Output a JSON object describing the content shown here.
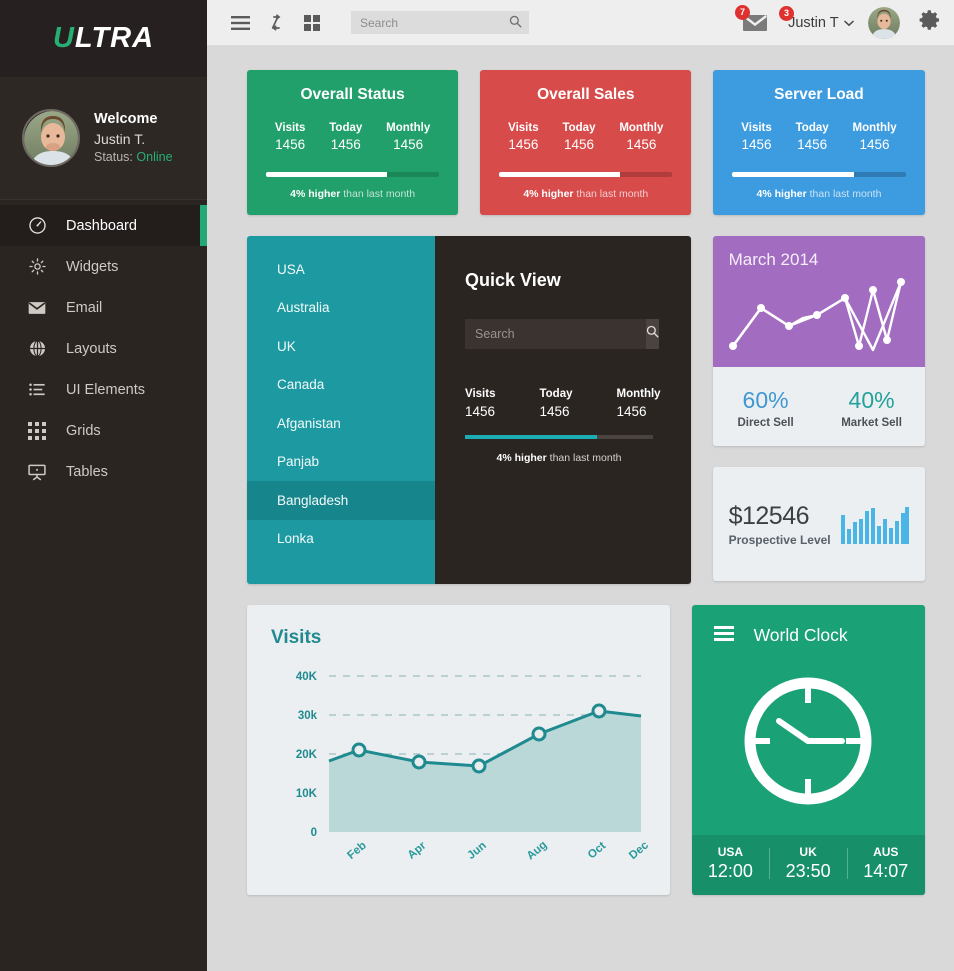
{
  "sidebar": {
    "logo_accent": "U",
    "logo_rest": "LTRA",
    "profile": {
      "welcome": "Welcome",
      "name": "Justin T.",
      "status_label": "Status:",
      "status_value": "Online"
    },
    "items": [
      {
        "label": "Dashboard",
        "icon": "speedometer-icon",
        "active": true
      },
      {
        "label": "Widgets",
        "icon": "gear-icon",
        "active": false
      },
      {
        "label": "Email",
        "icon": "envelope-icon",
        "active": false
      },
      {
        "label": "Layouts",
        "icon": "globe-icon",
        "active": false
      },
      {
        "label": "UI Elements",
        "icon": "list-icon",
        "active": false
      },
      {
        "label": "Grids",
        "icon": "grid-icon",
        "active": false
      },
      {
        "label": "Tables",
        "icon": "presentation-icon",
        "active": false
      }
    ]
  },
  "topbar": {
    "menu_icon": "hamburger-icon",
    "refresh_icon": "sync-icon",
    "apps_icon": "grid-apps-icon",
    "search_placeholder": "Search",
    "search_value": "",
    "mail_badge": "7",
    "user_badge": "3",
    "user_name": "Justin T",
    "settings_icon": "gear-icon"
  },
  "stat_cards": [
    {
      "title": "Overall Status",
      "color": "#22a06b",
      "track": "#1b8658",
      "metrics": [
        {
          "label": "Visits",
          "value": "1456"
        },
        {
          "label": "Today",
          "value": "1456"
        },
        {
          "label": "Monthly",
          "value": "1456"
        }
      ],
      "progress": 70,
      "note_strong": "4% higher",
      "note_rest": " than last month"
    },
    {
      "title": "Overall Sales",
      "color": "#d84b4b",
      "track": "#b13c3c",
      "metrics": [
        {
          "label": "Visits",
          "value": "1456"
        },
        {
          "label": "Today",
          "value": "1456"
        },
        {
          "label": "Monthly",
          "value": "1456"
        }
      ],
      "progress": 70,
      "note_strong": "4% higher",
      "note_rest": " than last month"
    },
    {
      "title": "Server Load",
      "color": "#3d9ce0",
      "track": "#2e7cb3",
      "metrics": [
        {
          "label": "Visits",
          "value": "1456"
        },
        {
          "label": "Today",
          "value": "1456"
        },
        {
          "label": "Monthly",
          "value": "1456"
        }
      ],
      "progress": 70,
      "note_strong": "4% higher",
      "note_rest": " than last month"
    }
  ],
  "countries": {
    "bg": "#1d9aa1",
    "items": [
      {
        "label": "USA",
        "active": false
      },
      {
        "label": "Australia",
        "active": false
      },
      {
        "label": "UK",
        "active": false
      },
      {
        "label": "Canada",
        "active": false
      },
      {
        "label": "Afganistan",
        "active": false
      },
      {
        "label": "Panjab",
        "active": false
      },
      {
        "label": "Bangladesh",
        "active": true
      },
      {
        "label": "Lonka",
        "active": false
      }
    ]
  },
  "quick_view": {
    "title": "Quick View",
    "search_placeholder": "Search",
    "search_value": "",
    "search_icon": "search-icon",
    "metrics": [
      {
        "label": "Visits",
        "value": "1456"
      },
      {
        "label": "Today",
        "value": "1456"
      },
      {
        "label": "Monthly",
        "value": "1456"
      }
    ],
    "progress": 70,
    "note_strong": "4% higher",
    "note_rest": " than last month"
  },
  "month_card": {
    "title": "March 2014",
    "accent": "#a26cc1",
    "direct": {
      "pct": "60%",
      "label": "Direct Sell"
    },
    "market": {
      "pct": "40%",
      "label": "Market Sell"
    }
  },
  "money_card": {
    "amount": "$12546",
    "label": "Prospective Level",
    "bar_color": "#4bb5e8"
  },
  "world_clock": {
    "title": "World Clock",
    "menu_icon": "hamburger-icon",
    "clock_icon": "analog-clock-icon",
    "zones": [
      {
        "city": "USA",
        "time": "12:00"
      },
      {
        "city": "UK",
        "time": "23:50"
      },
      {
        "city": "AUS",
        "time": "14:07"
      }
    ]
  },
  "chart_data": [
    {
      "type": "area",
      "title": "Visits",
      "xlabel": "",
      "ylabel": "",
      "categories": [
        "Feb",
        "Apr",
        "Jun",
        "Aug",
        "Oct",
        "Dec"
      ],
      "x": [
        0,
        1,
        2,
        3,
        4,
        5
      ],
      "values": [
        21000,
        18000,
        17000,
        25000,
        31000,
        29500
      ],
      "ytick_labels": [
        "0",
        "10K",
        "20K",
        "30k",
        "40K"
      ],
      "ytick_values": [
        0,
        10000,
        20000,
        30000,
        40000
      ],
      "ylim": [
        0,
        44000
      ],
      "grid": true,
      "grid_style": "dashed-horizontal",
      "legend": "none",
      "line_color": "#1f8a8f",
      "fill_color": "#b9d8d7",
      "marker": "circle-open"
    },
    {
      "type": "line",
      "title": "March 2014",
      "categories": [
        "1",
        "2",
        "3",
        "4",
        "5",
        "6",
        "7",
        "8",
        "9"
      ],
      "values": [
        14,
        52,
        30,
        42,
        60,
        12,
        78,
        22,
        88
      ],
      "ylim": [
        0,
        100
      ],
      "grid": false,
      "legend": "none",
      "line_color": "#ffffff",
      "marker": "circle-filled"
    },
    {
      "type": "bar",
      "title": "",
      "categories": [
        "1",
        "2",
        "3",
        "4",
        "5",
        "6",
        "7",
        "8",
        "9",
        "10",
        "11",
        "12"
      ],
      "values": [
        72,
        38,
        54,
        62,
        82,
        90,
        45,
        62,
        40,
        58,
        78,
        95
      ],
      "ylim": [
        0,
        100
      ],
      "grid": false,
      "legend": "none",
      "bar_color": "#4bb5e8"
    }
  ]
}
